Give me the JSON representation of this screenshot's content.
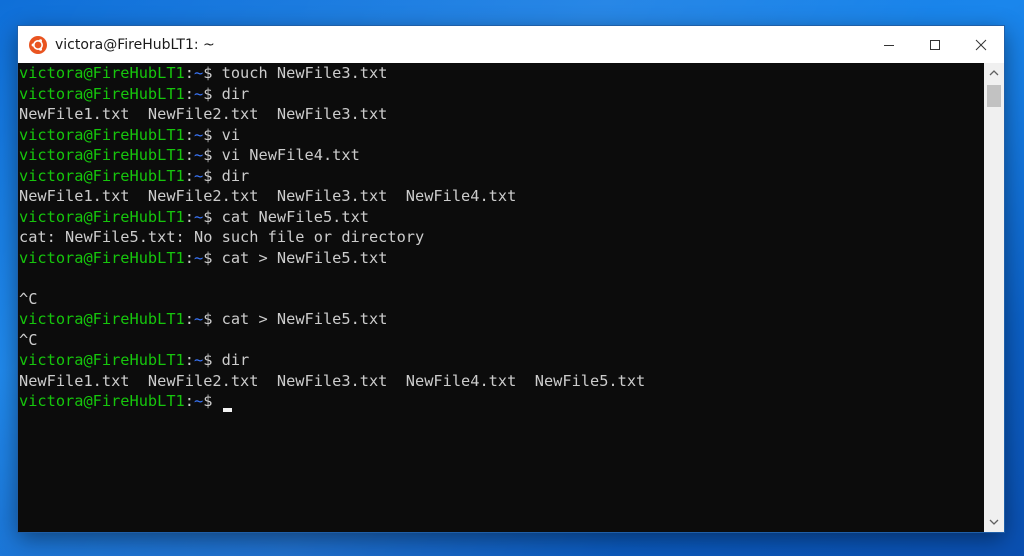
{
  "window": {
    "title": "victora@FireHubLT1: ~",
    "icon": "ubuntu-icon",
    "controls": [
      "minimize-icon",
      "maximize-icon",
      "close-icon"
    ]
  },
  "prompt": {
    "user": "victora@FireHubLT1",
    "separator": ":",
    "path": "~",
    "symbol": "$ "
  },
  "terminal": {
    "lines": [
      {
        "type": "prompt",
        "command": "touch NewFile3.txt"
      },
      {
        "type": "prompt",
        "command": "dir"
      },
      {
        "type": "output",
        "text": "NewFile1.txt  NewFile2.txt  NewFile3.txt"
      },
      {
        "type": "prompt",
        "command": "vi"
      },
      {
        "type": "prompt",
        "command": "vi NewFile4.txt"
      },
      {
        "type": "prompt",
        "command": "dir"
      },
      {
        "type": "output",
        "text": "NewFile1.txt  NewFile2.txt  NewFile3.txt  NewFile4.txt"
      },
      {
        "type": "prompt",
        "command": "cat NewFile5.txt"
      },
      {
        "type": "output",
        "text": "cat: NewFile5.txt: No such file or directory"
      },
      {
        "type": "prompt",
        "command": "cat > NewFile5.txt"
      },
      {
        "type": "output",
        "text": ""
      },
      {
        "type": "output",
        "text": "^C"
      },
      {
        "type": "prompt",
        "command": "cat > NewFile5.txt"
      },
      {
        "type": "output",
        "text": "^C"
      },
      {
        "type": "prompt",
        "command": "dir"
      },
      {
        "type": "output",
        "text": "NewFile1.txt  NewFile2.txt  NewFile3.txt  NewFile4.txt  NewFile5.txt"
      },
      {
        "type": "prompt",
        "command": "",
        "cursor": true
      }
    ]
  },
  "colors": {
    "user": "#16c60c",
    "path": "#3b78ff",
    "text": "#cccccc",
    "background": "#0c0c0c",
    "ubuntu": "#e95420"
  }
}
